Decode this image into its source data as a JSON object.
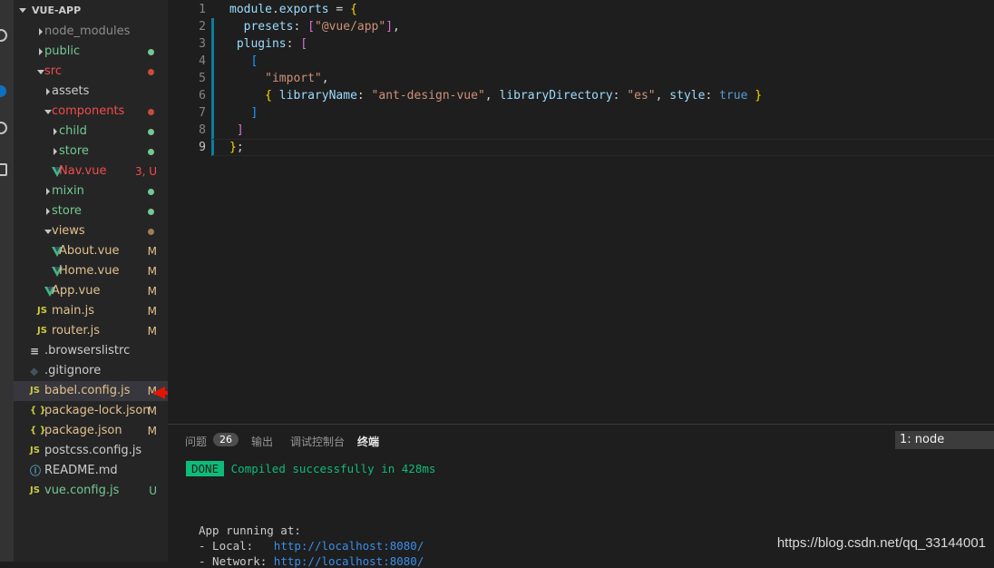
{
  "explorer": {
    "title": "VUE-APP",
    "items": [
      {
        "label": "node_modules",
        "kind": "folder",
        "depth": 1,
        "open": false,
        "color": "#8b8b8b",
        "dot": "",
        "badge": ""
      },
      {
        "label": "public",
        "kind": "folder",
        "depth": 1,
        "open": false,
        "color": "#73c991",
        "dot": "#73c991",
        "badge": ""
      },
      {
        "label": "src",
        "kind": "folder",
        "depth": 1,
        "open": true,
        "color": "#e2c08d",
        "dot": "#c74e39",
        "badge": "",
        "labelColor": "#f14c4c"
      },
      {
        "label": "assets",
        "kind": "folder",
        "depth": 2,
        "open": false,
        "color": "#cccccc",
        "dot": "",
        "badge": ""
      },
      {
        "label": "components",
        "kind": "folder",
        "depth": 2,
        "open": true,
        "color": "#f14c4c",
        "dot": "#c74e39",
        "badge": ""
      },
      {
        "label": "child",
        "kind": "folder",
        "depth": 3,
        "open": false,
        "color": "#73c991",
        "dot": "#73c991",
        "badge": ""
      },
      {
        "label": "store",
        "kind": "folder",
        "depth": 3,
        "open": false,
        "color": "#73c991",
        "dot": "#73c991",
        "badge": ""
      },
      {
        "label": "Nav.vue",
        "kind": "vue",
        "depth": 3,
        "color": "#f14c4c",
        "dot": "",
        "badge": "3, U",
        "badgeColor": "#f14c4c"
      },
      {
        "label": "mixin",
        "kind": "folder",
        "depth": 2,
        "open": false,
        "color": "#73c991",
        "dot": "#73c991",
        "badge": ""
      },
      {
        "label": "store",
        "kind": "folder",
        "depth": 2,
        "open": false,
        "color": "#73c991",
        "dot": "#73c991",
        "badge": ""
      },
      {
        "label": "views",
        "kind": "folder",
        "depth": 2,
        "open": true,
        "color": "#e2c08d",
        "dot": "#a07c52",
        "badge": ""
      },
      {
        "label": "About.vue",
        "kind": "vue",
        "depth": 3,
        "color": "#e2c08d",
        "dot": "",
        "badge": "M",
        "badgeColor": "#e2c08d"
      },
      {
        "label": "Home.vue",
        "kind": "vue",
        "depth": 3,
        "color": "#e2c08d",
        "dot": "",
        "badge": "M",
        "badgeColor": "#e2c08d"
      },
      {
        "label": "App.vue",
        "kind": "vue",
        "depth": 2,
        "color": "#e2c08d",
        "dot": "",
        "badge": "M",
        "badgeColor": "#e2c08d"
      },
      {
        "label": "main.js",
        "kind": "js",
        "depth": 2,
        "color": "#e2c08d",
        "dot": "",
        "badge": "M",
        "badgeColor": "#e2c08d"
      },
      {
        "label": "router.js",
        "kind": "js",
        "depth": 2,
        "color": "#e2c08d",
        "dot": "",
        "badge": "M",
        "badgeColor": "#e2c08d"
      },
      {
        "label": ".browserslistrc",
        "kind": "list",
        "depth": 1,
        "color": "#cccccc",
        "dot": "",
        "badge": ""
      },
      {
        "label": ".gitignore",
        "kind": "git",
        "depth": 1,
        "color": "#cccccc",
        "dot": "",
        "badge": ""
      },
      {
        "label": "babel.config.js",
        "kind": "js",
        "depth": 1,
        "color": "#e2c08d",
        "dot": "",
        "badge": "M",
        "badgeColor": "#e2c08d",
        "selected": true
      },
      {
        "label": "package-lock.json",
        "kind": "json",
        "depth": 1,
        "color": "#e2c08d",
        "dot": "",
        "badge": "M",
        "badgeColor": "#e2c08d"
      },
      {
        "label": "package.json",
        "kind": "json",
        "depth": 1,
        "color": "#e2c08d",
        "dot": "",
        "badge": "M",
        "badgeColor": "#e2c08d"
      },
      {
        "label": "postcss.config.js",
        "kind": "js",
        "depth": 1,
        "color": "#cccccc",
        "dot": "",
        "badge": ""
      },
      {
        "label": "README.md",
        "kind": "info",
        "depth": 1,
        "color": "#cccccc",
        "dot": "",
        "badge": ""
      },
      {
        "label": "vue.config.js",
        "kind": "js",
        "depth": 1,
        "color": "#73c991",
        "dot": "",
        "badge": "U",
        "badgeColor": "#73c991"
      }
    ]
  },
  "editor": {
    "line_numbers": [
      "1",
      "2",
      "3",
      "4",
      "5",
      "6",
      "7",
      "8",
      "9"
    ],
    "current_line": "9"
  },
  "panel": {
    "tabs": {
      "problems": "问题",
      "problems_count": "26",
      "output": "输出",
      "debug": "调试控制台",
      "terminal": "终端"
    },
    "terminal_select": "1: node",
    "done_badge": "DONE",
    "compiled": "Compiled successfully in 428ms",
    "running": "App running at:",
    "local_label": "- Local:   ",
    "local_url": "http://localhost:8080/",
    "network_label": "- Network: ",
    "network_url": "http://localhost:8080/"
  },
  "watermark": "https://blog.csdn.net/qq_33144001"
}
